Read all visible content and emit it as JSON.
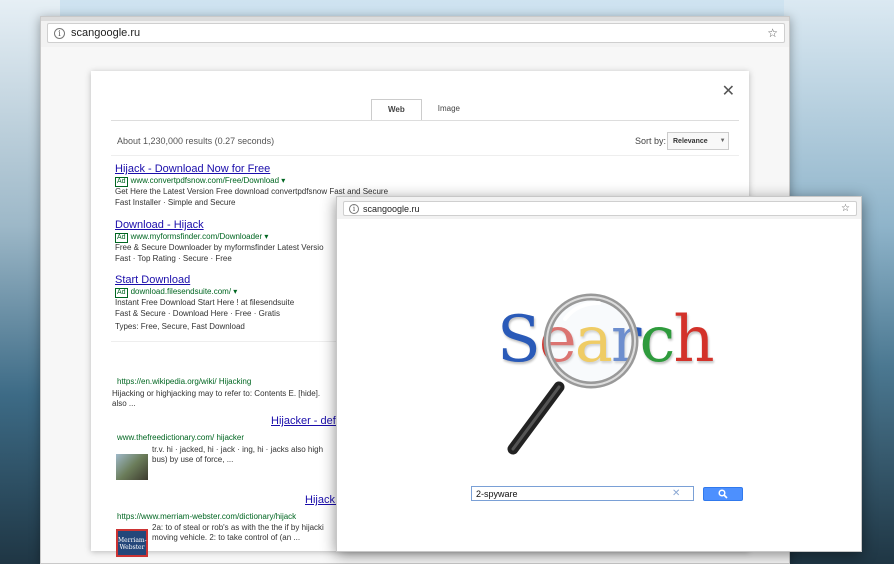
{
  "back_window": {
    "address": "scangoogle.ru",
    "results": {
      "tabs": [
        {
          "label": "Web"
        },
        {
          "label": "Image"
        }
      ],
      "count_text": "About 1,230,000 results (0.27 seconds)",
      "sort_label": "Sort by:",
      "sort_value": "Relevance",
      "ads": [
        {
          "title": "Hijack - Download Now for Free",
          "badge": "Ad",
          "url": "www.convertpdfsnow.com/Free/Download ▾",
          "desc": "Get Here the Latest Version Free download convertpdfsnow Fast and Secure",
          "extra": "Fast Installer · Simple and Secure"
        },
        {
          "title": "Download - Hijack",
          "badge": "Ad",
          "url": "www.myformsfinder.com/Downloader ▾",
          "desc": "Free & Secure Downloader by myformsfinder Latest Versio",
          "extra": "Fast · Top Rating · Secure · Free"
        },
        {
          "title": "Start Download",
          "badge": "Ad",
          "url": "download.filesendsuite.com/ ▾",
          "desc": "Instant Free Download Start Here ! at filesendsuite",
          "extra": "Fast & Secure · Download Here · Free · Gratis",
          "extra2": "Types: Free, Secure, Fast Download"
        }
      ],
      "organic": [
        {
          "url": "https://en.wikipedia.org/wiki/ Hijacking",
          "desc1": "Hijacking or highjacking may to refer to: Contents E. [hide].",
          "desc2": "also ..."
        },
        {
          "title": "Hijacker - defi",
          "url": "www.thefreedictionary.com/ hijacker",
          "desc1": "tr.v. hi · jacked, hi · jack · ing, hi · jacks also high",
          "desc2": "bus) by use of force, ..."
        },
        {
          "title": "Hijack I",
          "url": "https://www.merriam-webster.com/dictionary/hijack",
          "desc1": "2a: to of steal or rob's as with the the if by hijacki",
          "desc2": "moving vehicle. 2: to take control of (an ...",
          "thumb_text": "Merriam-Webster"
        }
      ]
    }
  },
  "front_window": {
    "address": "scangoogle.ru",
    "logo_letters": [
      "S",
      "e",
      "a",
      "r",
      "c",
      "h"
    ],
    "search_value": "2-spyware"
  }
}
